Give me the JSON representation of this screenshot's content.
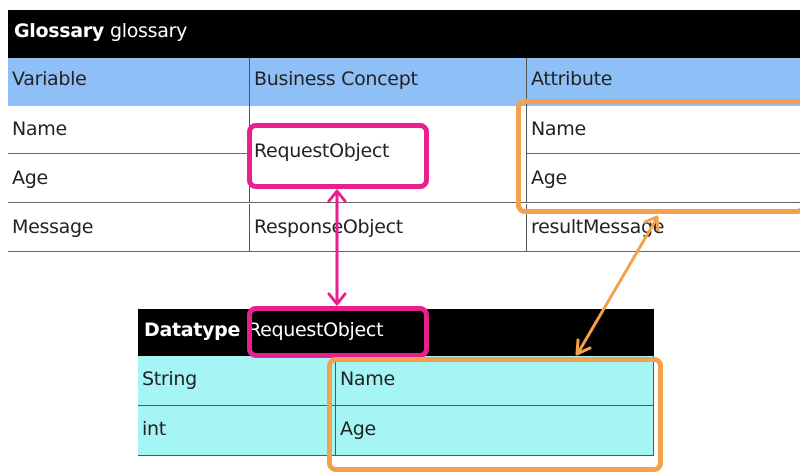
{
  "glossary": {
    "title_bold": "Glossary",
    "title_name": "glossary",
    "headers": [
      "Variable",
      "Business Concept",
      "Attribute"
    ],
    "rows": [
      {
        "variable": "Name",
        "attribute": "Name"
      },
      {
        "variable": "Age",
        "attribute": "Age"
      },
      {
        "variable": "Message",
        "concept": "ResponseObject",
        "attribute": "resultMessage"
      }
    ],
    "merged_concept": "RequestObject"
  },
  "datatype": {
    "title_bold": "Datatype",
    "title_name": "RequestObject",
    "rows": [
      {
        "type": "String",
        "name": "Name"
      },
      {
        "type": "int",
        "name": "Age"
      }
    ]
  },
  "colors": {
    "header_blue": "#8fbff7",
    "datatype_cyan": "#a6f5f5",
    "pink_highlight": "#ea1f8f",
    "orange_highlight": "#f5a04a"
  }
}
